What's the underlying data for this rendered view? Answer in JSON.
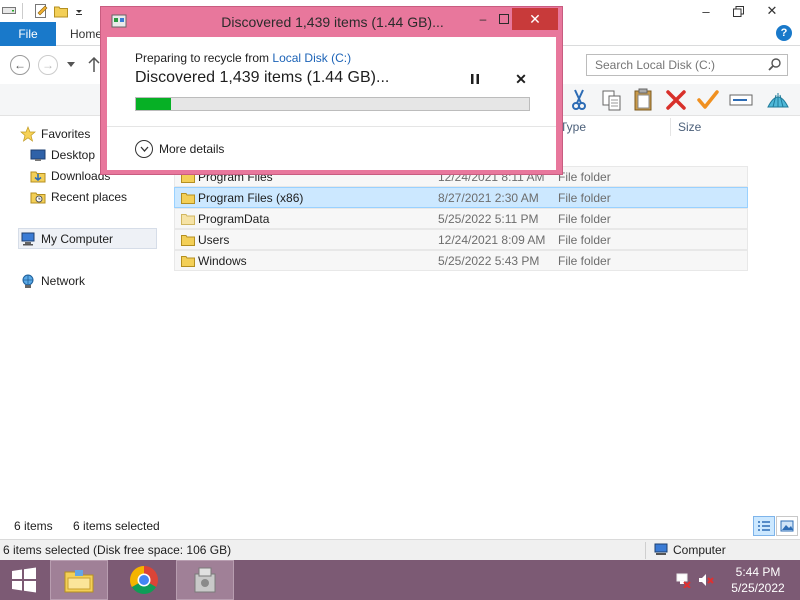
{
  "explorer": {
    "ribbon": {
      "file_tab": "File",
      "home_tab": "Home",
      "help": "?"
    },
    "search": {
      "placeholder": "Search Local Disk (C:)"
    },
    "sidebar": {
      "favorites": "Favorites",
      "desktop": "Desktop",
      "downloads": "Downloads",
      "recent": "Recent places",
      "my_computer": "My Computer",
      "network": "Network"
    },
    "columns": {
      "type": "Type",
      "size": "Size"
    },
    "rows": [
      {
        "name": "Program Files",
        "date": "12/24/2021 8:11 AM",
        "type": "File folder"
      },
      {
        "name": "Program Files (x86)",
        "date": "8/27/2021 2:30 AM",
        "type": "File folder"
      },
      {
        "name": "ProgramData",
        "date": "5/25/2022 5:11 PM",
        "type": "File folder"
      },
      {
        "name": "Users",
        "date": "12/24/2021 8:09 AM",
        "type": "File folder"
      },
      {
        "name": "Windows",
        "date": "5/25/2022 5:43 PM",
        "type": "File folder"
      }
    ],
    "status": {
      "count": "6 items",
      "selected": "6 items selected"
    },
    "details": {
      "text": "6 items selected (Disk free space: 106 GB)",
      "computer": "Computer"
    }
  },
  "dialog": {
    "title": "Discovered 1,439 items (1.44 GB)...",
    "preparing_prefix": "Preparing to recycle from ",
    "preparing_link": "Local Disk (C:)",
    "heading": "Discovered 1,439 items (1.44 GB)...",
    "progress_percent": 9,
    "more_details": "More details",
    "colors": {
      "frame": "#e8779c",
      "progress": "#06b025",
      "close": "#c83a3a"
    }
  },
  "taskbar": {
    "time": "5:44 PM",
    "date": "5/25/2022",
    "items": [
      "file-explorer",
      "chrome",
      "control-panel"
    ]
  }
}
